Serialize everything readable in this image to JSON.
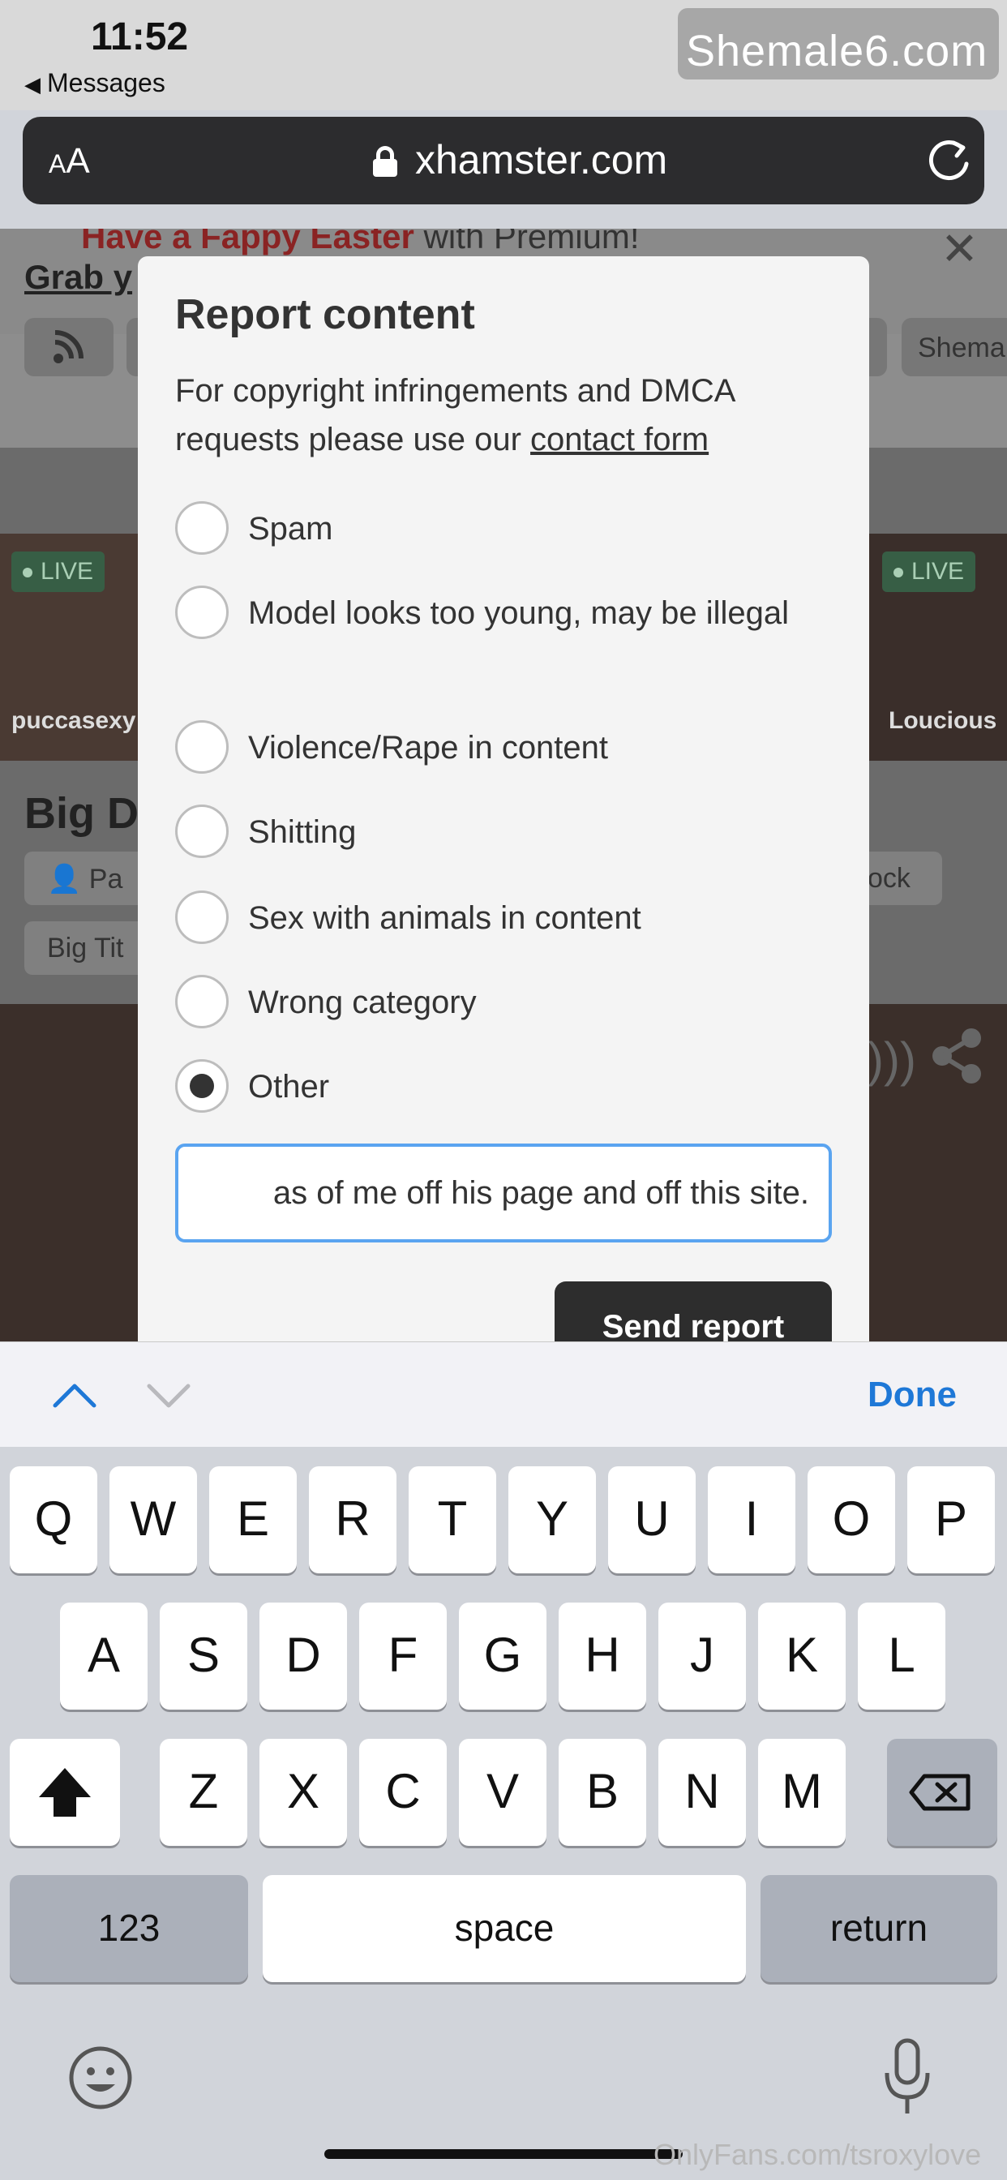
{
  "status": {
    "time": "11:52",
    "back_label": "Messages",
    "watermark": "Shemale6.com"
  },
  "urlbar": {
    "aa_label": "AA",
    "domain": "xhamster.com"
  },
  "background_page": {
    "promo_highlight": "Have a Fappy Easter",
    "promo_rest": " with Premium!",
    "promo_link": "Grab y",
    "chip_shem": "Shema",
    "live_label": "LIVE",
    "user_left": "puccasexy",
    "user_right": "Loucious",
    "video_title": "Big Di",
    "tag_pa": "Pa",
    "tag_ock": "ock",
    "tag_bigtit": "Big Tit"
  },
  "modal": {
    "title": "Report content",
    "desc_prefix": "For copyright infringements and DMCA requests please use our ",
    "desc_link": "contact form",
    "options": [
      {
        "label": "Spam",
        "checked": false
      },
      {
        "label": "Model looks too young, may be illegal",
        "checked": false
      },
      {
        "label": "Violence/Rape in content",
        "checked": false
      },
      {
        "label": "Shitting",
        "checked": false
      },
      {
        "label": "Sex with animals in content",
        "checked": false
      },
      {
        "label": "Wrong category",
        "checked": false
      },
      {
        "label": "Other",
        "checked": true
      }
    ],
    "text_value": "as of me off his page and off this site.",
    "send_label": "Send report"
  },
  "accessory": {
    "done_label": "Done"
  },
  "keyboard": {
    "row1": [
      "Q",
      "W",
      "E",
      "R",
      "T",
      "Y",
      "U",
      "I",
      "O",
      "P"
    ],
    "row2": [
      "A",
      "S",
      "D",
      "F",
      "G",
      "H",
      "J",
      "K",
      "L"
    ],
    "row3": [
      "Z",
      "X",
      "C",
      "V",
      "B",
      "N",
      "M"
    ],
    "numbers_label": "123",
    "space_label": "space",
    "return_label": "return"
  },
  "footer_watermark": "OnlyFans.com/tsroxylove"
}
